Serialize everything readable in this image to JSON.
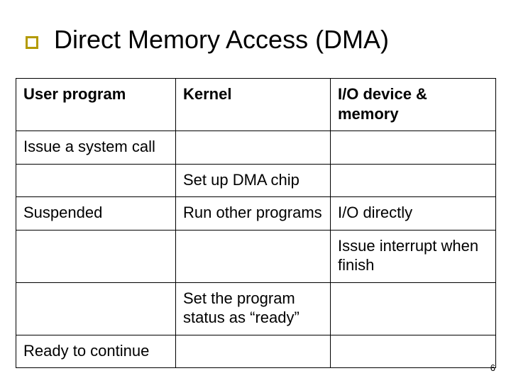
{
  "title": "Direct Memory Access (DMA)",
  "table": {
    "headers": {
      "col1": "User program",
      "col2": "Kernel",
      "col3": "I/O device & memory"
    },
    "rows": [
      {
        "c1": "Issue a system call",
        "c2": "",
        "c3": ""
      },
      {
        "c1": "",
        "c2": "Set up DMA chip",
        "c3": ""
      },
      {
        "c1": "Suspended",
        "c2": "Run other programs",
        "c3": "I/O directly"
      },
      {
        "c1": "",
        "c2": "",
        "c3": "Issue interrupt when finish"
      },
      {
        "c1": "",
        "c2": "Set the program status as “ready”",
        "c3": ""
      },
      {
        "c1": "Ready to continue",
        "c2": "",
        "c3": ""
      }
    ]
  },
  "page_number": "6"
}
